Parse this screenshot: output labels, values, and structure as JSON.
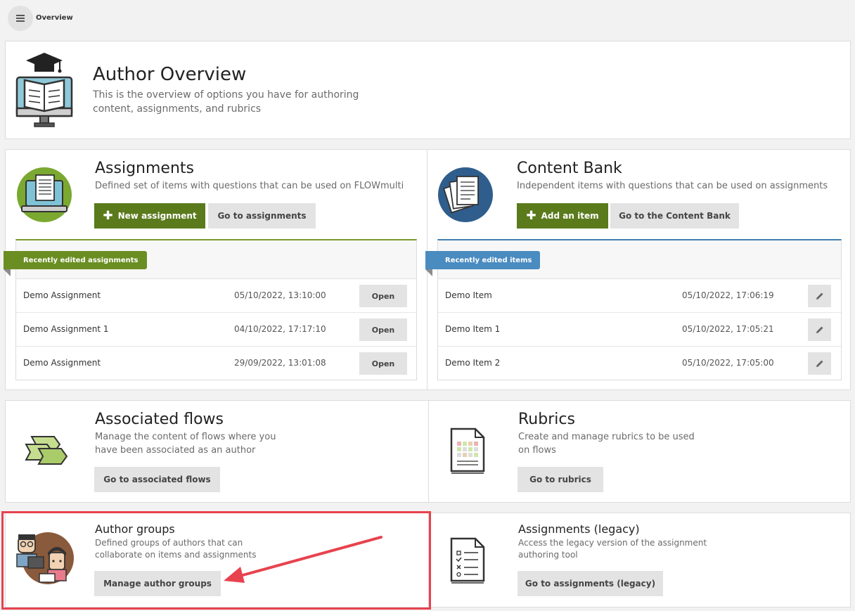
{
  "topbar": {
    "breadcrumb": "Overview",
    "menu_icon": "hamburger-icon"
  },
  "header": {
    "title": "Author Overview",
    "description": "This is the overview of options you have for authoring content, assignments, and rubrics"
  },
  "assignments": {
    "title": "Assignments",
    "description": "Defined set of items with questions that can be used on FLOWmulti",
    "new_label": "New assignment",
    "goto_label": "Go to assignments",
    "recent_label": "Recently edited assignments",
    "open_label": "Open",
    "rows": [
      {
        "name": "Demo Assignment",
        "date": "05/10/2022, 13:10:00"
      },
      {
        "name": "Demo Assignment 1",
        "date": "04/10/2022, 17:17:10"
      },
      {
        "name": "Demo Assignment",
        "date": "29/09/2022, 13:01:08"
      }
    ]
  },
  "content_bank": {
    "title": "Content Bank",
    "description": "Independent items with questions that can be used on assignments",
    "add_label": "Add an item",
    "goto_label": "Go to the Content Bank",
    "recent_label": "Recently edited items",
    "rows": [
      {
        "name": "Demo Item",
        "date": "05/10/2022, 17:06:19"
      },
      {
        "name": "Demo Item 1",
        "date": "05/10/2022, 17:05:21"
      },
      {
        "name": "Demo Item 2",
        "date": "05/10/2022, 17:05:00"
      }
    ]
  },
  "flows": {
    "title": "Associated flows",
    "description": "Manage the content of flows where you have been associated as an author",
    "button_label": "Go to associated flows"
  },
  "rubrics": {
    "title": "Rubrics",
    "description": "Create and manage rubrics to be used on flows",
    "button_label": "Go to rubrics"
  },
  "author_groups": {
    "title": "Author groups",
    "description": "Defined groups of authors that can collaborate on items and assignments",
    "button_label": "Manage author groups"
  },
  "legacy": {
    "title": "Assignments (legacy)",
    "description": "Access the legacy version of the assignment authoring tool",
    "button_label": "Go to assignments (legacy)"
  },
  "colors": {
    "green": "#5a7a1c",
    "ribbon_green": "#6b8e23",
    "ribbon_blue": "#4a8bc0",
    "highlight": "#e8424e"
  }
}
